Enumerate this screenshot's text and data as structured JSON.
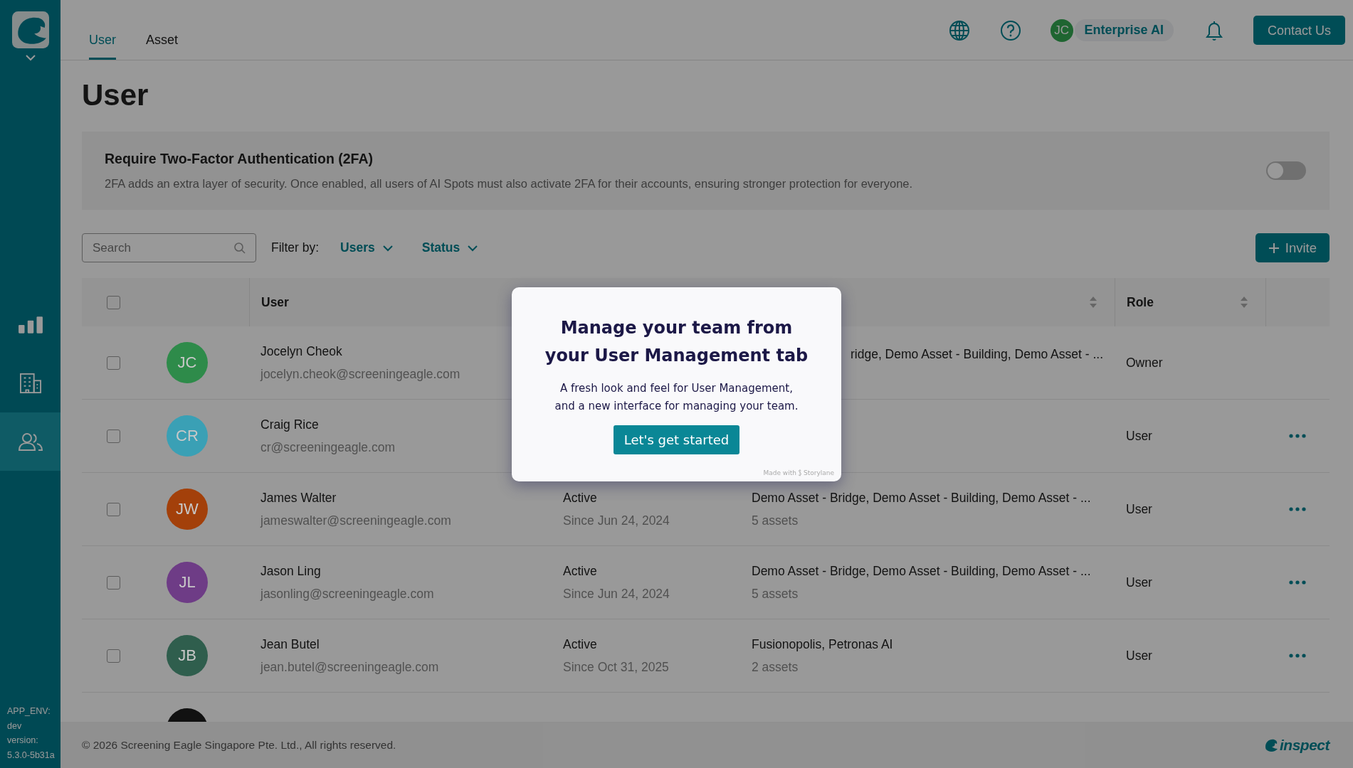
{
  "sidebar": {
    "nav": [
      {
        "kind": "chart",
        "selected": false
      },
      {
        "kind": "building",
        "selected": false
      },
      {
        "kind": "users",
        "selected": true
      }
    ],
    "env_lines": [
      "APP_ENV:",
      "dev",
      "version:",
      "5.3.0-5b31a"
    ]
  },
  "tabs": [
    {
      "label": "User",
      "selected": true
    },
    {
      "label": "Asset",
      "selected": false
    }
  ],
  "header": {
    "avatar_initials": "JC",
    "org": "Enterprise AI",
    "contact_button": "Contact Us"
  },
  "page_title": "User",
  "two_factor": {
    "title": "Require Two-Factor Authentication (2FA)",
    "description": "2FA adds an extra layer of security. Once enabled, all users of AI Spots must also activate 2FA for their accounts, ensuring stronger protection for everyone.",
    "on": false
  },
  "toolbar": {
    "search_placeholder": "Search",
    "filter_label": "Filter by:",
    "filters": [
      "Users",
      "Status"
    ],
    "invite_button": "Invite"
  },
  "table": {
    "select_all_checked": false,
    "columns": [
      {
        "kind": "user",
        "label": "User",
        "sortable": false
      },
      {
        "kind": "status"
      },
      {
        "kind": "assets",
        "sortable": true
      },
      {
        "kind": "role",
        "label": "Role",
        "sortable": true
      }
    ],
    "rows": [
      {
        "checked": false,
        "initials": "JC",
        "color": "#2e8b4a",
        "name": "Jocelyn Cheok",
        "email": "jocelyn.cheok@screeningeagle.com",
        "assets": "ridge, Demo Asset - Building, Demo Asset - ...",
        "assets_cut_left": true,
        "role": "Owner",
        "menu": false
      },
      {
        "checked": false,
        "initials": "CR",
        "color": "#3aa0b5",
        "name": "Craig Rice",
        "email": "cr@screeningeagle.com",
        "role": "User",
        "menu": true
      },
      {
        "checked": false,
        "initials": "JW",
        "color": "#a3400a",
        "name": "James Walter",
        "email": "jameswalter@screeningeagle.com",
        "status": "Active",
        "since": "Since Jun 24, 2024",
        "assets": "Demo Asset - Bridge, Demo Asset - Building, Demo Asset - ...",
        "asset_count": "5 assets",
        "role": "User",
        "menu": true
      },
      {
        "checked": false,
        "initials": "JL",
        "color": "#6e3c86",
        "name": "Jason Ling",
        "email": "jasonling@screeningeagle.com",
        "status": "Active",
        "since": "Since Jun 24, 2024",
        "assets": "Demo Asset - Bridge, Demo Asset - Building, Demo Asset - ...",
        "asset_count": "5 assets",
        "role": "User",
        "menu": true
      },
      {
        "checked": false,
        "initials": "JB",
        "color": "#2f5e4d",
        "name": "Jean Butel",
        "email": "jean.butel@screeningeagle.com",
        "status": "Active",
        "since": "Since Oct 31, 2025",
        "assets": "Fusionopolis, Petronas AI",
        "asset_count": "2 assets",
        "role": "User",
        "menu": true
      },
      {
        "color": "#111111",
        "menu": false
      }
    ]
  },
  "footer": {
    "copyright": "© 2026 Screening Eagle Singapore Pte. Ltd., All rights reserved.",
    "brand": "inspect"
  },
  "dialog": {
    "title_lines": [
      "Manage your team from",
      "your User Management tab"
    ],
    "body_lines": [
      "A fresh look and feel for User Management,",
      "and a new interface for managing your team."
    ],
    "button": "Let's get started",
    "credit_prefix": "Made with",
    "credit_brand": "Storylane"
  }
}
